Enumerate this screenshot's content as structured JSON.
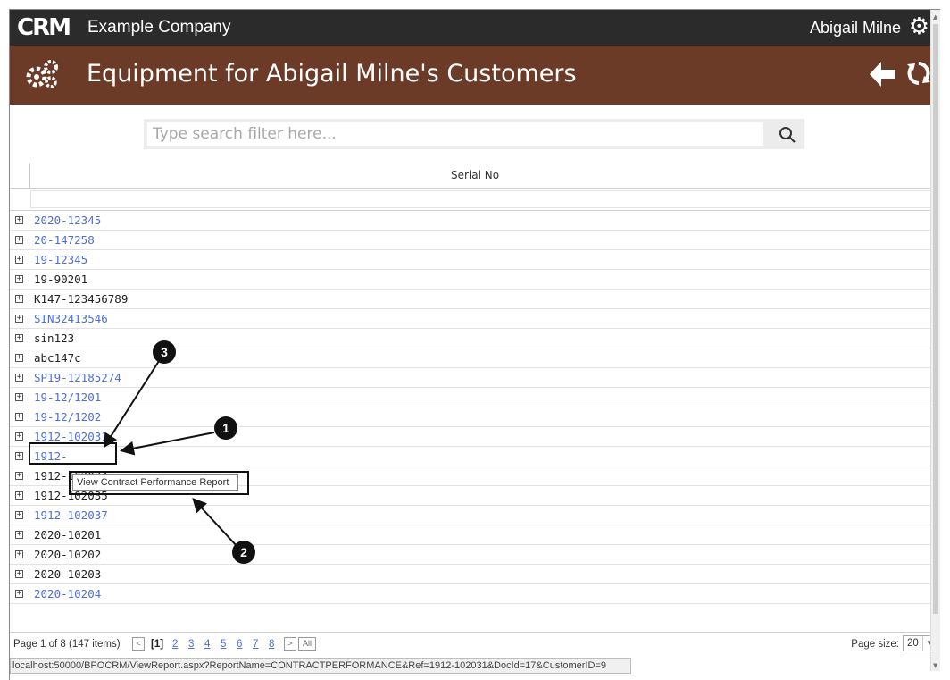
{
  "header": {
    "logo_text": "CRM",
    "company_name": "Example Company",
    "user_name": "Abigail Milne"
  },
  "page": {
    "title": "Equipment for Abigail Milne's Customers"
  },
  "search": {
    "placeholder": "Type search filter here..."
  },
  "grid": {
    "column_header": "Serial No",
    "rows": [
      {
        "serial": "2020-12345",
        "link": true
      },
      {
        "serial": "20-147258",
        "link": true
      },
      {
        "serial": "19-12345",
        "link": true
      },
      {
        "serial": "19-90201",
        "link": false
      },
      {
        "serial": "K147-123456789",
        "link": false
      },
      {
        "serial": "SIN32413546",
        "link": true
      },
      {
        "serial": "sin123",
        "link": false
      },
      {
        "serial": "abc147c",
        "link": false
      },
      {
        "serial": "SP19-12185274",
        "link": true
      },
      {
        "serial": "19-12/1201",
        "link": true
      },
      {
        "serial": "19-12/1202",
        "link": true
      },
      {
        "serial": "1912-102031",
        "link": true
      },
      {
        "serial": "1912-",
        "link": true
      },
      {
        "serial": "1912-102034",
        "link": false
      },
      {
        "serial": "1912-102035",
        "link": false
      },
      {
        "serial": "1912-102037",
        "link": true
      },
      {
        "serial": "2020-10201",
        "link": false
      },
      {
        "serial": "2020-10202",
        "link": false
      },
      {
        "serial": "2020-10203",
        "link": false
      },
      {
        "serial": "2020-10204",
        "link": true
      }
    ]
  },
  "pager": {
    "info": "Page 1 of 8 (147 items)",
    "prev": "<",
    "current": "[1]",
    "pages": [
      "2",
      "3",
      "4",
      "5",
      "6",
      "7",
      "8"
    ],
    "next": ">",
    "all": "All",
    "page_size_label": "Page size:",
    "page_size": "20"
  },
  "tooltip": {
    "text": "View Contract Performance Report"
  },
  "status_url": "localhost:50000/BPOCRM/ViewReport.aspx?ReportName=CONTRACTPERFORMANCE&Ref=1912-102031&DocId=17&CustomerID=9",
  "annotations": {
    "markers": [
      "1",
      "2",
      "3"
    ]
  },
  "colors": {
    "topbar": "#2b2b2b",
    "titlebar": "#6b3b28",
    "link": "#4f6fd6"
  }
}
